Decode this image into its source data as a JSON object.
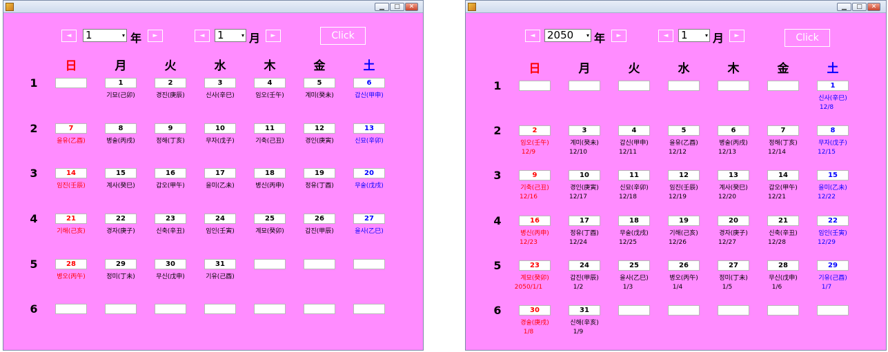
{
  "windows": [
    {
      "title_buttons": [
        "▁",
        "□",
        "✕"
      ],
      "year": "1",
      "year_unit": "年",
      "month": "1",
      "month_unit": "月",
      "prev_year": "◄",
      "next_year": "►",
      "prev_month": "◄",
      "next_month": "►",
      "click_label": "Click",
      "weekdays": [
        "日",
        "月",
        "火",
        "水",
        "木",
        "金",
        "土"
      ],
      "week_numbers": [
        "1",
        "2",
        "3",
        "4",
        "5",
        "6"
      ],
      "days": [
        [
          {
            "d": ""
          },
          {
            "d": "1",
            "l": "기묘(己卯)"
          },
          {
            "d": "2",
            "l": "경진(庚辰)"
          },
          {
            "d": "3",
            "l": "신사(辛巳)"
          },
          {
            "d": "4",
            "l": "임오(壬午)"
          },
          {
            "d": "5",
            "l": "계미(癸未)"
          },
          {
            "d": "6",
            "l": "갑신(甲申)"
          }
        ],
        [
          {
            "d": "7",
            "l": "을유(乙酉)"
          },
          {
            "d": "8",
            "l": "병술(丙戌)"
          },
          {
            "d": "9",
            "l": "정해(丁亥)"
          },
          {
            "d": "10",
            "l": "무자(戊子)"
          },
          {
            "d": "11",
            "l": "기축(己丑)"
          },
          {
            "d": "12",
            "l": "경인(庚寅)"
          },
          {
            "d": "13",
            "l": "신묘(辛卯)"
          }
        ],
        [
          {
            "d": "14",
            "l": "임진(壬辰)"
          },
          {
            "d": "15",
            "l": "계사(癸巳)"
          },
          {
            "d": "16",
            "l": "갑오(甲午)"
          },
          {
            "d": "17",
            "l": "을미(乙未)"
          },
          {
            "d": "18",
            "l": "병신(丙申)"
          },
          {
            "d": "19",
            "l": "정유(丁酉)"
          },
          {
            "d": "20",
            "l": "무술(戊戌)"
          }
        ],
        [
          {
            "d": "21",
            "l": "기해(己亥)"
          },
          {
            "d": "22",
            "l": "경자(庚子)"
          },
          {
            "d": "23",
            "l": "신축(辛丑)"
          },
          {
            "d": "24",
            "l": "임인(壬寅)"
          },
          {
            "d": "25",
            "l": "계묘(癸卯)"
          },
          {
            "d": "26",
            "l": "갑진(甲辰)"
          },
          {
            "d": "27",
            "l": "을사(乙巳)"
          }
        ],
        [
          {
            "d": "28",
            "l": "병오(丙午)"
          },
          {
            "d": "29",
            "l": "정미(丁未)"
          },
          {
            "d": "30",
            "l": "무신(戊申)"
          },
          {
            "d": "31",
            "l": "기유(己酉)"
          },
          {
            "d": ""
          },
          {
            "d": ""
          },
          {
            "d": ""
          }
        ],
        [
          {
            "d": ""
          },
          {
            "d": ""
          },
          {
            "d": ""
          },
          {
            "d": ""
          },
          {
            "d": ""
          },
          {
            "d": ""
          },
          {
            "d": ""
          }
        ]
      ]
    },
    {
      "title_buttons": [
        "▁",
        "□",
        "✕"
      ],
      "year": "2050",
      "year_unit": "年",
      "month": "1",
      "month_unit": "月",
      "prev_year": "◄",
      "next_year": "►",
      "prev_month": "◄",
      "next_month": "►",
      "click_label": "Click",
      "weekdays": [
        "日",
        "月",
        "火",
        "水",
        "木",
        "金",
        "土"
      ],
      "week_numbers": [
        "1",
        "2",
        "3",
        "4",
        "5",
        "6"
      ],
      "days": [
        [
          {
            "d": ""
          },
          {
            "d": ""
          },
          {
            "d": ""
          },
          {
            "d": ""
          },
          {
            "d": ""
          },
          {
            "d": ""
          },
          {
            "d": "1",
            "l": "신사(辛巳)",
            "s": "12/8"
          }
        ],
        [
          {
            "d": "2",
            "l": "임오(壬午)",
            "s": "12/9"
          },
          {
            "d": "3",
            "l": "계미(癸未)",
            "s": "12/10"
          },
          {
            "d": "4",
            "l": "갑신(甲申)",
            "s": "12/11"
          },
          {
            "d": "5",
            "l": "을유(乙酉)",
            "s": "12/12"
          },
          {
            "d": "6",
            "l": "병술(丙戌)",
            "s": "12/13"
          },
          {
            "d": "7",
            "l": "정해(丁亥)",
            "s": "12/14"
          },
          {
            "d": "8",
            "l": "무자(戊子)",
            "s": "12/15"
          }
        ],
        [
          {
            "d": "9",
            "l": "기축(己丑)",
            "s": "12/16"
          },
          {
            "d": "10",
            "l": "경인(庚寅)",
            "s": "12/17"
          },
          {
            "d": "11",
            "l": "신묘(辛卯)",
            "s": "12/18"
          },
          {
            "d": "12",
            "l": "임진(壬辰)",
            "s": "12/19"
          },
          {
            "d": "13",
            "l": "계사(癸巳)",
            "s": "12/20"
          },
          {
            "d": "14",
            "l": "갑오(甲午)",
            "s": "12/21"
          },
          {
            "d": "15",
            "l": "을미(乙未)",
            "s": "12/22"
          }
        ],
        [
          {
            "d": "16",
            "l": "병신(丙申)",
            "s": "12/23"
          },
          {
            "d": "17",
            "l": "정유(丁酉)",
            "s": "12/24"
          },
          {
            "d": "18",
            "l": "무술(戊戌)",
            "s": "12/25"
          },
          {
            "d": "19",
            "l": "기해(己亥)",
            "s": "12/26"
          },
          {
            "d": "20",
            "l": "경자(庚子)",
            "s": "12/27"
          },
          {
            "d": "21",
            "l": "신축(辛丑)",
            "s": "12/28"
          },
          {
            "d": "22",
            "l": "임인(壬寅)",
            "s": "12/29"
          }
        ],
        [
          {
            "d": "23",
            "l": "계묘(癸卯)",
            "s": "2050/1/1"
          },
          {
            "d": "24",
            "l": "갑진(甲辰)",
            "s": "1/2"
          },
          {
            "d": "25",
            "l": "을사(乙巳)",
            "s": "1/3"
          },
          {
            "d": "26",
            "l": "병오(丙午)",
            "s": "1/4"
          },
          {
            "d": "27",
            "l": "정미(丁未)",
            "s": "1/5"
          },
          {
            "d": "28",
            "l": "무신(戊申)",
            "s": "1/6"
          },
          {
            "d": "29",
            "l": "기유(己酉)",
            "s": "1/7"
          }
        ],
        [
          {
            "d": "30",
            "l": "경술(庚戌)",
            "s": "1/8"
          },
          {
            "d": "31",
            "l": "신해(辛亥)",
            "s": "1/9"
          },
          {
            "d": ""
          },
          {
            "d": ""
          },
          {
            "d": ""
          },
          {
            "d": ""
          },
          {
            "d": ""
          }
        ]
      ]
    }
  ],
  "colors": {
    "window_bg": "#ff8cff",
    "sunday": "#ff0000",
    "saturday": "#0000ff",
    "weekday": "#000000"
  }
}
